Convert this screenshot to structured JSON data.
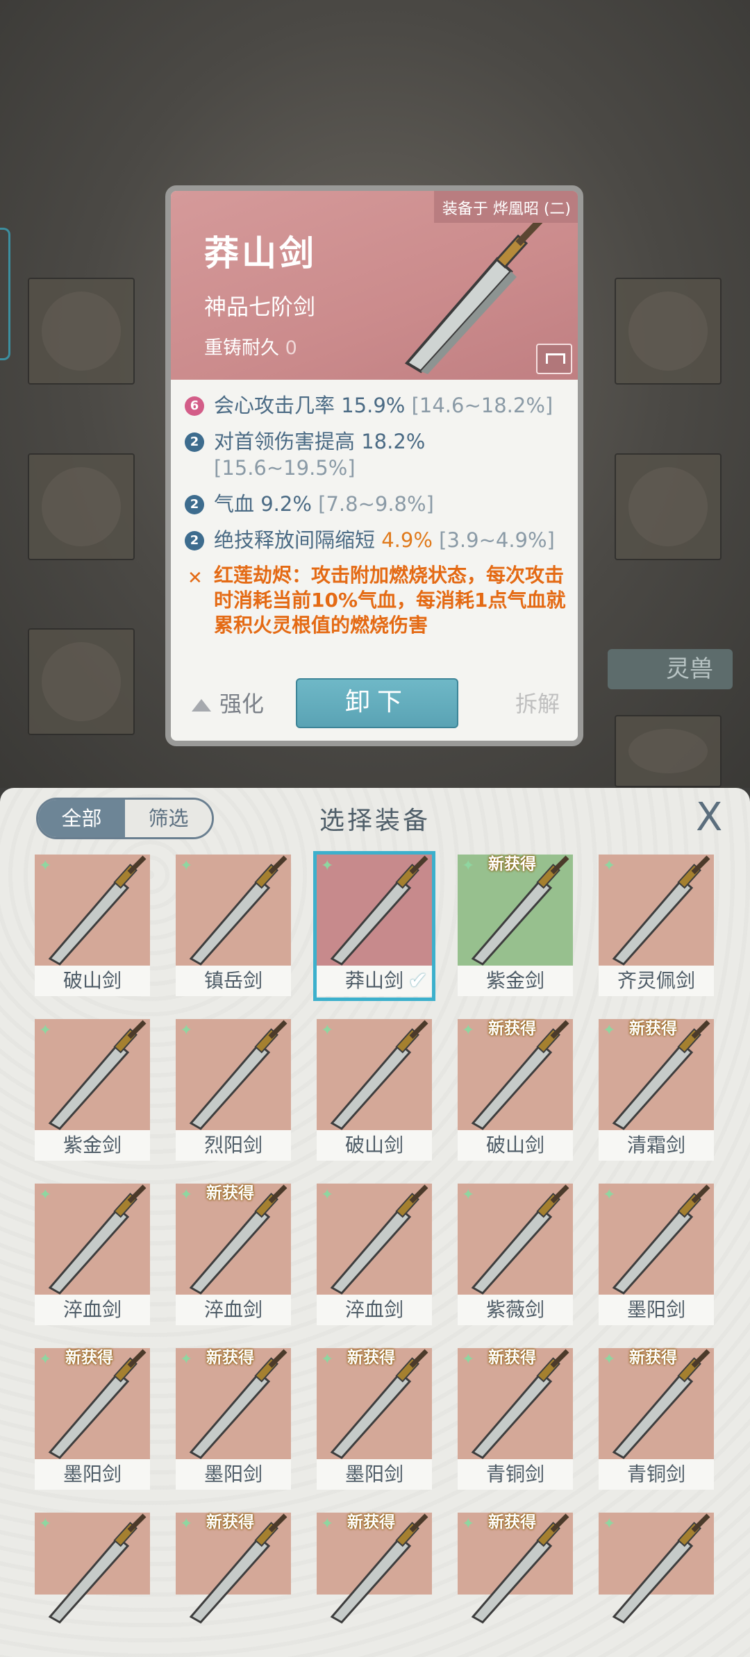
{
  "background": {
    "spirit_button": "灵兽"
  },
  "detail": {
    "equipped_on": "装备于 烨凰昭 (二)",
    "name": "莽山剑",
    "grade": "神品七阶剑",
    "reforge_label": "重铸耐久",
    "reforge_value": "0",
    "stats": [
      {
        "badge": "6",
        "badge_color": "#d35d88",
        "name": "会心攻击几率",
        "value": "15.9%",
        "range": "[14.6~18.2%]"
      },
      {
        "badge": "2",
        "badge_color": "#3d6c8e",
        "name": "对首领伤害提高",
        "value": "18.2%",
        "range": "[15.6~19.5%]"
      },
      {
        "badge": "2",
        "badge_color": "#3d6c8e",
        "name": "气血",
        "value": "9.2%",
        "range": "[7.8~9.8%]"
      },
      {
        "badge": "2",
        "badge_color": "#3d6c8e",
        "name": "绝技释放间隔缩短",
        "value": "4.9%",
        "range": "[3.9~4.9%]"
      }
    ],
    "skill_text": "红莲劫烬：攻击附加燃烧状态，每次攻击时消耗当前10%气血，每消耗1点气血就累积火灵根值的燃烧伤害",
    "enhance": "强化",
    "unequip": "卸下",
    "dismantle": "拆解"
  },
  "panel": {
    "tab_all": "全部",
    "tab_filter": "筛选",
    "title": "选择装备",
    "close": "X",
    "new_badge": "新获得",
    "items": [
      {
        "label": "破山剑",
        "bg": "tan",
        "new": false,
        "selected": false
      },
      {
        "label": "镇岳剑",
        "bg": "tan",
        "new": false,
        "selected": false
      },
      {
        "label": "莽山剑",
        "bg": "pink",
        "new": false,
        "selected": true
      },
      {
        "label": "紫金剑",
        "bg": "green",
        "new": true,
        "selected": false
      },
      {
        "label": "齐灵佩剑",
        "bg": "tan",
        "new": false,
        "selected": false
      },
      {
        "label": "紫金剑",
        "bg": "tan",
        "new": false,
        "selected": false
      },
      {
        "label": "烈阳剑",
        "bg": "tan",
        "new": false,
        "selected": false
      },
      {
        "label": "破山剑",
        "bg": "tan",
        "new": false,
        "selected": false
      },
      {
        "label": "破山剑",
        "bg": "tan",
        "new": true,
        "selected": false
      },
      {
        "label": "清霜剑",
        "bg": "tan",
        "new": true,
        "selected": false
      },
      {
        "label": "淬血剑",
        "bg": "tan",
        "new": false,
        "selected": false
      },
      {
        "label": "淬血剑",
        "bg": "tan",
        "new": true,
        "selected": false
      },
      {
        "label": "淬血剑",
        "bg": "tan",
        "new": false,
        "selected": false
      },
      {
        "label": "紫薇剑",
        "bg": "tan",
        "new": false,
        "selected": false
      },
      {
        "label": "墨阳剑",
        "bg": "tan",
        "new": false,
        "selected": false
      },
      {
        "label": "墨阳剑",
        "bg": "tan",
        "new": true,
        "selected": false
      },
      {
        "label": "墨阳剑",
        "bg": "tan",
        "new": true,
        "selected": false
      },
      {
        "label": "墨阳剑",
        "bg": "tan",
        "new": true,
        "selected": false
      },
      {
        "label": "青铜剑",
        "bg": "tan",
        "new": true,
        "selected": false
      },
      {
        "label": "青铜剑",
        "bg": "tan",
        "new": true,
        "selected": false
      },
      {
        "label": "",
        "bg": "tan",
        "new": false,
        "selected": false
      },
      {
        "label": "",
        "bg": "tan",
        "new": true,
        "selected": false
      },
      {
        "label": "",
        "bg": "tan",
        "new": true,
        "selected": false
      },
      {
        "label": "",
        "bg": "tan",
        "new": true,
        "selected": false
      },
      {
        "label": "",
        "bg": "tan",
        "new": false,
        "selected": false
      }
    ]
  }
}
